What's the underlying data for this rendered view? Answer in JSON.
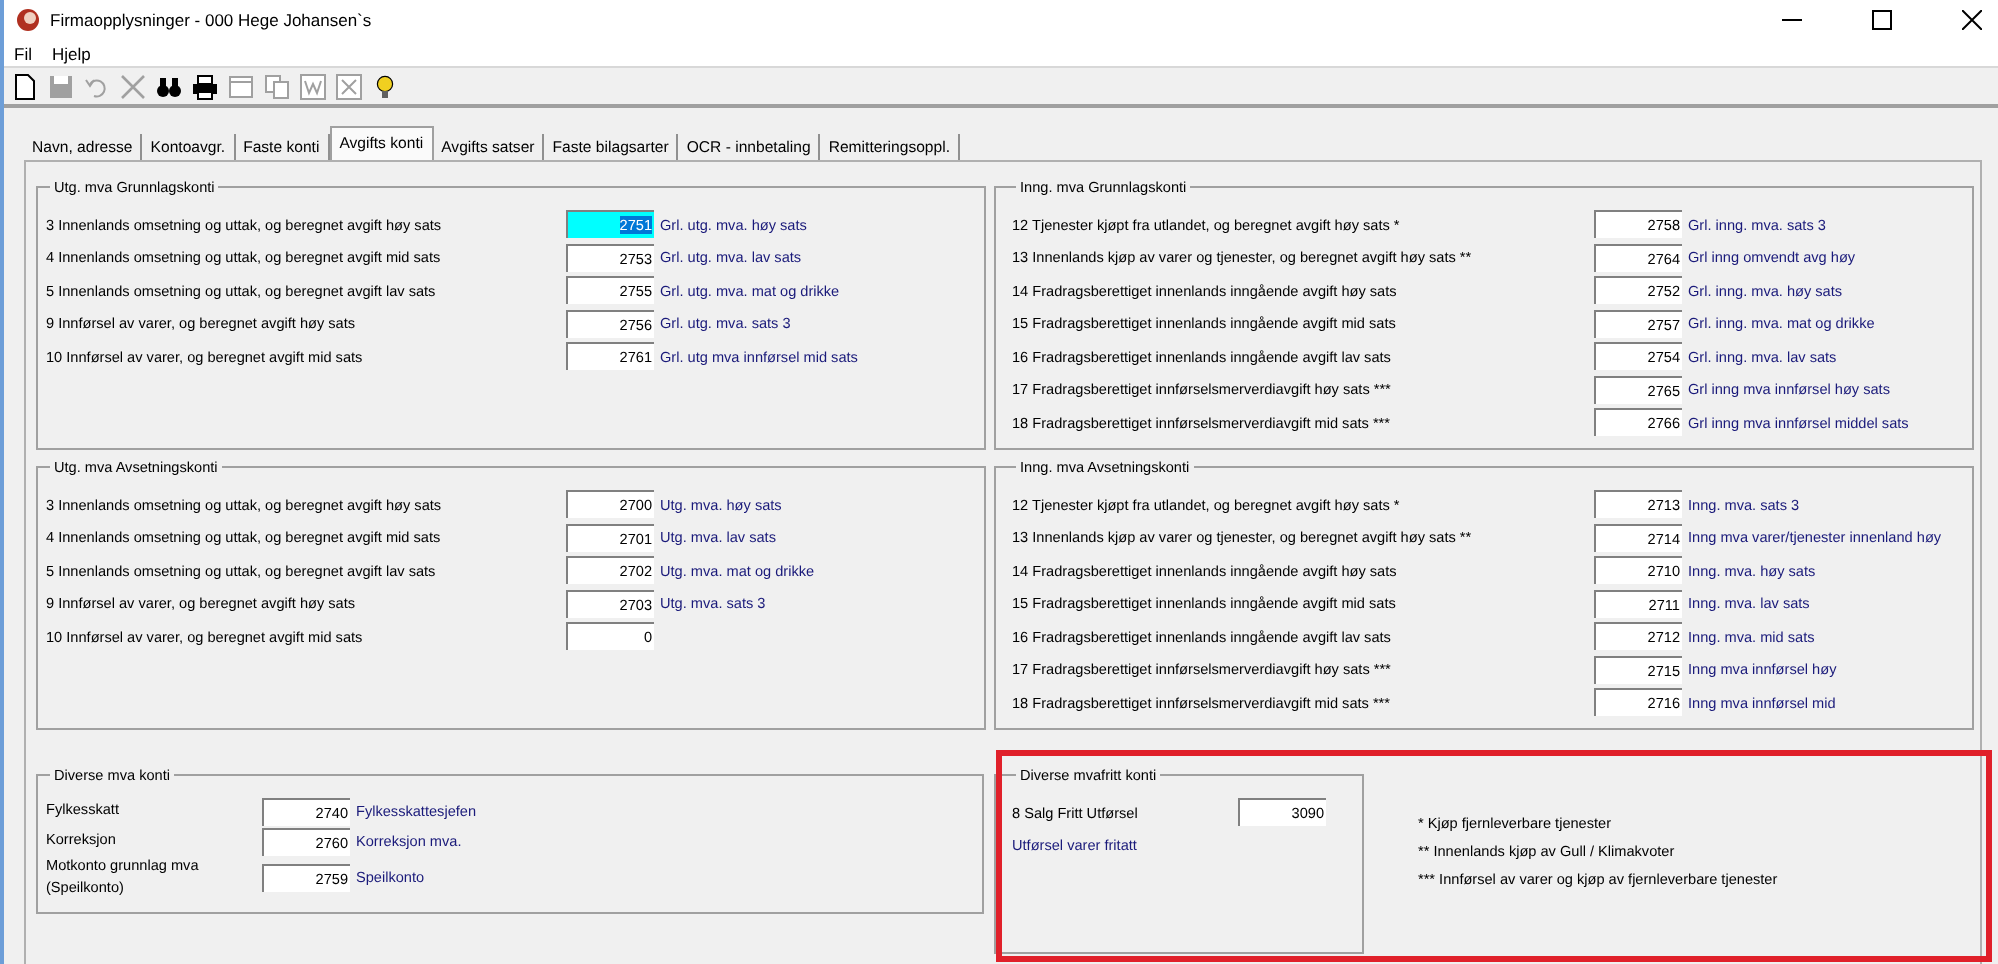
{
  "window": {
    "title": "Firmaopplysninger - 000 Hege Johansen`s"
  },
  "menu": [
    "Fil",
    "Hjelp"
  ],
  "toolbar": [
    {
      "kind": "new",
      "disabled": false
    },
    {
      "kind": "save",
      "disabled": true
    },
    {
      "kind": "undo",
      "disabled": true
    },
    {
      "kind": "delete",
      "disabled": true
    },
    {
      "kind": "find",
      "disabled": false
    },
    {
      "kind": "print",
      "disabled": false
    },
    {
      "kind": "form",
      "disabled": true
    },
    {
      "kind": "copy",
      "disabled": true
    },
    {
      "kind": "word",
      "disabled": true
    },
    {
      "kind": "excel",
      "disabled": true
    },
    {
      "kind": "help",
      "disabled": false
    }
  ],
  "tabs": [
    {
      "label": "Navn, adresse",
      "selected": false
    },
    {
      "label": "Kontoavgr.",
      "selected": false
    },
    {
      "label": "Faste konti",
      "selected": false
    },
    {
      "label": "Avgifts konti",
      "selected": true
    },
    {
      "label": "Avgifts satser",
      "selected": false
    },
    {
      "label": "Faste bilagsarter",
      "selected": false
    },
    {
      "label": "OCR - innbetaling",
      "selected": false
    },
    {
      "label": "Remitteringsoppl.",
      "selected": false
    }
  ],
  "groups": [
    {
      "title": "Utg. mva Grunnlagskonti",
      "rows": [
        {
          "label": "3 Innenlands omsetning og uttak, og beregnet avgift høy sats",
          "value": "2751",
          "account": "Grl. utg. mva. høy sats",
          "focused": true
        },
        {
          "label": "4 Innenlands omsetning og uttak, og beregnet avgift mid sats",
          "value": "2753",
          "account": "Grl. utg. mva. lav sats",
          "focused": false
        },
        {
          "label": "5 Innenlands omsetning og uttak, og beregnet avgift lav sats",
          "value": "2755",
          "account": "Grl. utg. mva. mat og drikke",
          "focused": false
        },
        {
          "label": "9 Innførsel av varer, og beregnet avgift høy sats",
          "value": "2756",
          "account": "Grl. utg. mva. sats 3",
          "focused": false
        },
        {
          "label": "10 Innførsel av varer, og beregnet avgift mid sats",
          "value": "2761",
          "account": "Grl. utg mva innførsel mid sats",
          "focused": false
        }
      ]
    },
    {
      "title": "Inng. mva Grunnlagskonti",
      "rows": [
        {
          "label": "12 Tjenester kjøpt fra utlandet, og beregnet avgift høy sats *",
          "value": "2758",
          "account": "Grl. inng. mva. sats 3",
          "focused": false
        },
        {
          "label": "13 Innenlands kjøp av varer og tjenester, og beregnet avgift høy sats **",
          "value": "2764",
          "account": "Grl inng omvendt avg høy",
          "focused": false
        },
        {
          "label": "14 Fradragsberettiget innenlands inngående avgift høy sats",
          "value": "2752",
          "account": "Grl. inng. mva. høy sats",
          "focused": false
        },
        {
          "label": "15 Fradragsberettiget innenlands inngående avgift mid sats",
          "value": "2757",
          "account": "Grl. inng. mva. mat og drikke",
          "focused": false
        },
        {
          "label": "16 Fradragsberettiget innenlands inngående avgift lav sats",
          "value": "2754",
          "account": "Grl. inng. mva. lav sats",
          "focused": false
        },
        {
          "label": "17 Fradragsberettiget innførselsmerverdiavgift høy sats ***",
          "value": "2765",
          "account": "Grl inng mva innførsel høy sats",
          "focused": false
        },
        {
          "label": "18 Fradragsberettiget innførselsmerverdiavgift mid sats ***",
          "value": "2766",
          "account": "Grl inng mva innførsel middel sats",
          "focused": false
        }
      ]
    },
    {
      "title": "Utg. mva Avsetningskonti",
      "rows": [
        {
          "label": "3 Innenlands omsetning og uttak, og beregnet avgift høy sats",
          "value": "2700",
          "account": "Utg. mva. høy sats",
          "focused": false
        },
        {
          "label": "4 Innenlands omsetning og uttak, og beregnet avgift mid sats",
          "value": "2701",
          "account": "Utg. mva. lav sats",
          "focused": false
        },
        {
          "label": "5 Innenlands omsetning og uttak, og beregnet avgift lav sats",
          "value": "2702",
          "account": "Utg. mva. mat og drikke",
          "focused": false
        },
        {
          "label": "9 Innførsel av varer, og beregnet avgift høy sats",
          "value": "2703",
          "account": "Utg. mva. sats 3",
          "focused": false
        },
        {
          "label": "10 Innførsel av varer, og beregnet avgift mid sats",
          "value": "0",
          "focused": false
        }
      ]
    },
    {
      "title": "Inng. mva Avsetningskonti",
      "rows": [
        {
          "label": "12 Tjenester kjøpt fra utlandet, og beregnet avgift høy sats *",
          "value": "2713",
          "account": "Inng. mva. sats 3",
          "focused": false
        },
        {
          "label": "13 Innenlands kjøp av varer og tjenester, og beregnet avgift høy sats **",
          "value": "2714",
          "account": "Inng mva varer/tjenester innenland høy",
          "focused": false
        },
        {
          "label": "14 Fradragsberettiget innenlands inngående avgift høy sats",
          "value": "2710",
          "account": "Inng. mva. høy sats",
          "focused": false
        },
        {
          "label": "15 Fradragsberettiget innenlands inngående avgift mid sats",
          "value": "2711",
          "account": "Inng. mva. lav sats",
          "focused": false
        },
        {
          "label": "16 Fradragsberettiget innenlands inngående avgift lav sats",
          "value": "2712",
          "account": "Inng. mva. mid sats",
          "focused": false
        },
        {
          "label": "17 Fradragsberettiget innførselsmerverdiavgift høy sats ***",
          "value": "2715",
          "account": "Inng mva innførsel høy",
          "focused": false
        },
        {
          "label": "18 Fradragsberettiget innførselsmerverdiavgift mid sats ***",
          "value": "2716",
          "account": "Inng mva innførsel mid",
          "focused": false
        }
      ]
    }
  ],
  "diverse": {
    "title": "Diverse mva konti",
    "rows": [
      {
        "label": "Fylkesskatt",
        "value": "2740",
        "account": "Fylkesskattesjefen"
      },
      {
        "label": "Korreksjon",
        "value": "2760",
        "account": "Korreksjon mva."
      },
      {
        "label": "Motkonto grunnlag mva (Speilkonto)",
        "value": "2759",
        "account": "Speilkonto"
      }
    ]
  },
  "mvafritt": {
    "title": "Diverse mvafritt konti",
    "label": "8 Salg Fritt Utførsel",
    "value": "3090",
    "account": "Utførsel varer fritatt"
  },
  "notes": [
    "* Kjøp fjernleverbare tjenester",
    "** Innenlands kjøp av Gull / Klimakvoter",
    "*** Innførsel av varer og kjøp av fjernleverbare tjenester"
  ]
}
